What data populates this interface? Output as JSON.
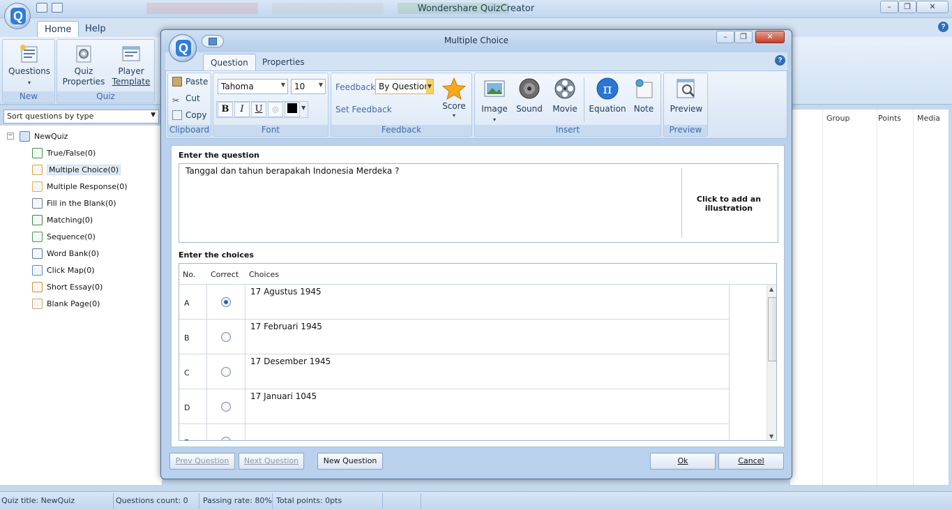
{
  "app": {
    "title": "Wondershare QuizCreator",
    "tabs": [
      "Home",
      "Help"
    ],
    "ribbon": {
      "new_group": {
        "label": "New",
        "questions_btn": "Questions"
      },
      "quiz_group": {
        "label": "Quiz",
        "quiz_properties_1": "Quiz",
        "quiz_properties_2": "Properties",
        "player_template_1": "Player",
        "player_template_2": "Template"
      }
    }
  },
  "left_panel": {
    "sort_select": "Sort questions by type",
    "tree_root": "NewQuiz",
    "tree_items": [
      {
        "label": "True/False(0)",
        "icon": "true-false-icon"
      },
      {
        "label": "Multiple Choice(0)",
        "icon": "multiple-choice-icon",
        "selected": true
      },
      {
        "label": "Multiple Response(0)",
        "icon": "multiple-response-icon"
      },
      {
        "label": "Fill in the Blank(0)",
        "icon": "fill-blank-icon"
      },
      {
        "label": "Matching(0)",
        "icon": "matching-icon"
      },
      {
        "label": "Sequence(0)",
        "icon": "sequence-icon"
      },
      {
        "label": "Word Bank(0)",
        "icon": "word-bank-icon"
      },
      {
        "label": "Click Map(0)",
        "icon": "click-map-icon"
      },
      {
        "label": "Short Essay(0)",
        "icon": "short-essay-icon"
      },
      {
        "label": "Blank Page(0)",
        "icon": "blank-page-icon"
      }
    ]
  },
  "right_panel": {
    "headers": [
      "Group",
      "Points",
      "Media"
    ]
  },
  "statusbar": {
    "quiz_title": "Quiz title: NewQuiz",
    "questions_count": "Questions count: 0",
    "passing_rate": "Passing rate: 80%",
    "total_points": "Total points: 0pts"
  },
  "dialog": {
    "title": "Multiple Choice",
    "tabs": [
      "Question",
      "Properties"
    ],
    "ribbon": {
      "clipboard": {
        "label": "Clipboard",
        "paste": "Paste",
        "cut": "Cut",
        "copy": "Copy"
      },
      "font": {
        "label": "Font",
        "family": "Tahoma",
        "size": "10",
        "bold": "B",
        "italic": "I",
        "underline": "U"
      },
      "feedback": {
        "label": "Feedback",
        "feedback_label": "Feedback:",
        "feedback_value": "By Question",
        "set_feedback": "Set Feedback",
        "score": "Score"
      },
      "insert": {
        "label": "Insert",
        "image": "Image",
        "sound": "Sound",
        "movie": "Movie",
        "equation": "Equation",
        "note": "Note"
      },
      "preview": {
        "label": "Preview",
        "preview_btn": "Preview"
      }
    },
    "question_section_label": "Enter the question",
    "question_text": "Tanggal dan tahun berapakah Indonesia Merdeka ?",
    "illustration_text": "Click to add an illustration",
    "choices_section_label": "Enter the choices",
    "choices_headers": {
      "no": "No.",
      "correct": "Correct",
      "choices": "Choices"
    },
    "choices": [
      {
        "no": "A",
        "text": "17 Agustus 1945",
        "correct": true
      },
      {
        "no": "B",
        "text": "17 Februari 1945",
        "correct": false
      },
      {
        "no": "C",
        "text": "17 Desember 1945",
        "correct": false
      },
      {
        "no": "D",
        "text": "17 Januari 1045",
        "correct": false
      },
      {
        "no": "E",
        "text": "",
        "correct": false
      }
    ],
    "buttons": {
      "prev": "Prev Question",
      "next": "Next Question",
      "new": "New Question",
      "ok": "Ok",
      "cancel": "Cancel"
    }
  },
  "colors": {
    "accent": "#2f7fd6",
    "ribbon_bg": "#d4e3f4",
    "selection": "#e1ebf7"
  }
}
